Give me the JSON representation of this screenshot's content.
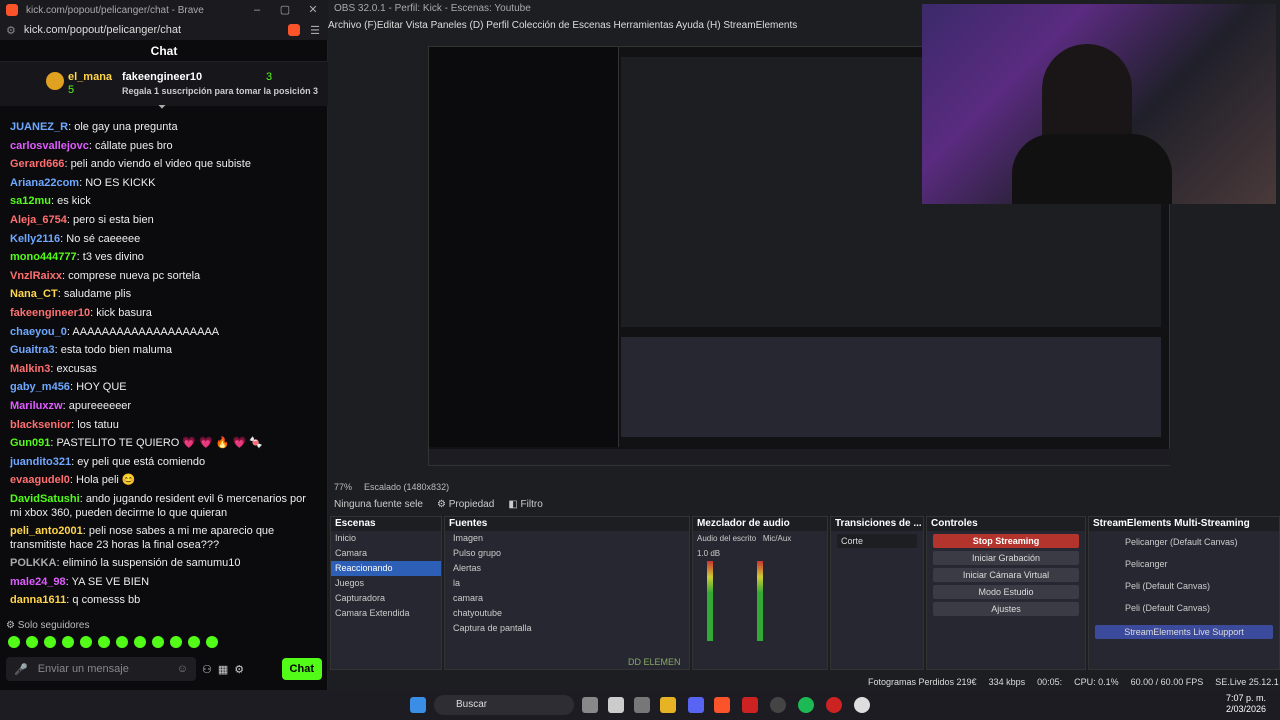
{
  "brave": {
    "title": "kick.com/popout/pelicanger/chat - Brave",
    "url": "kick.com/popout/pelicanger/chat",
    "chat_title": "Chat",
    "gift": {
      "user1": "el_mana",
      "count1": "5",
      "user2": "fakeengineer10",
      "count2": "3",
      "text": "Regala 1 suscripción para tomar la posición 3"
    },
    "messages": [
      {
        "user": "JUANEZ_R",
        "color": "#6fa8ff",
        "text": "ole gay una pregunta"
      },
      {
        "user": "carlosvallejovc",
        "color": "#e05cff",
        "text": "cállate pues bro"
      },
      {
        "user": "Gerard666",
        "color": "#ff6f6f",
        "text": "peli ando viendo el video que subiste"
      },
      {
        "user": "Ariana22com",
        "color": "#6fa8ff",
        "text": "NO ES KICKK"
      },
      {
        "user": "sa12mu",
        "color": "#53fc18",
        "text": "es kick"
      },
      {
        "user": "Aleja_6754",
        "color": "#ff6f6f",
        "text": "pero si esta bien"
      },
      {
        "user": "Kelly2116",
        "color": "#6fa8ff",
        "text": "No sé caeeeee"
      },
      {
        "user": "mono444777",
        "color": "#53fc18",
        "text": "t3 ves divino"
      },
      {
        "user": "VnzlRaixx",
        "color": "#ff6f6f",
        "text": "comprese nueva pc sortela"
      },
      {
        "user": "Nana_CT",
        "color": "#ffd54a",
        "text": "saludame plis"
      },
      {
        "user": "fakeengineer10",
        "color": "#ff6f6f",
        "text": "kick basura"
      },
      {
        "user": "chaeyou_0",
        "color": "#6fa8ff",
        "text": "AAAAAAAAAAAAAAAAAAAA"
      },
      {
        "user": "Guaitra3",
        "color": "#6fa8ff",
        "text": "esta todo bien maluma"
      },
      {
        "user": "Malkin3",
        "color": "#ff6f6f",
        "text": "excusas"
      },
      {
        "user": "gaby_m456",
        "color": "#6fa8ff",
        "text": "HOY QUE"
      },
      {
        "user": "Mariluxzw",
        "color": "#e05cff",
        "text": "apureeeeeer"
      },
      {
        "user": "blacksenior",
        "color": "#ff6f6f",
        "text": "los tatuu"
      },
      {
        "user": "Gun091",
        "color": "#53fc18",
        "text": "PASTELITO TE QUIERO 💗 💗 🔥 💗 🍬"
      },
      {
        "user": "juandito321",
        "color": "#6fa8ff",
        "text": "ey peli que está comiendo"
      },
      {
        "user": "evaagudel0",
        "color": "#ff6f6f",
        "text": "Hola peli 😊"
      },
      {
        "user": "DavidSatushi",
        "color": "#53fc18",
        "text": "ando jugando resident evil 6 mercenarios por mi xbox 360, pueden decirme lo que quieran"
      },
      {
        "user": "peli_anto2001",
        "color": "#ffd54a",
        "text": "peli nose sabes a mi me aparecio que transmitiste hace 23 horas la final osea???"
      },
      {
        "user": "POLKKA",
        "color": "#aaaaaa",
        "text": "eliminó la suspensión de samumu10"
      },
      {
        "user": "male24_98",
        "color": "#e05cff",
        "text": "YA SE VE BIEN"
      },
      {
        "user": "danna1611",
        "color": "#ffd54a",
        "text": "q comesss bb"
      }
    ],
    "mods_label": "Solo seguidores",
    "input_placeholder": "Enviar un mensaje",
    "chat_button": "Chat"
  },
  "obs": {
    "title": "OBS 32.0.1 - Perfil: Kick - Escenas: Youtube",
    "menu": "Archivo (F)Editar  Vista  Paneles (D)  Perfil  Colección de Escenas  Herramientas  Ayuda (H)  StreamElements",
    "zoom": "77%",
    "scaled": "Escalado (1480x832)",
    "no_source": "Ninguna fuente sele",
    "properties": "Propiedad",
    "filters": "Filtro",
    "scenes_title": "Escenas",
    "scenes": [
      "Inicio",
      "Camara",
      "Reaccionando",
      "Juegos",
      "Capturadora",
      "Camara Extendida"
    ],
    "selected_scene": "Reaccionando",
    "sources_title": "Fuentes",
    "sources": [
      "Imagen",
      "Pulso grupo",
      "Alertas",
      "la",
      "camara",
      "chatyoutube",
      "Captura de pantalla"
    ],
    "mixer_title": "Mezclador de audio",
    "mixer_ch1": "Audio del escrito",
    "mixer_ch2": "Mic/Aux",
    "mixer_db": "1.0 dB",
    "transitions_title": "Transiciones de ...",
    "transition": "Corte",
    "controls_title": "Controles",
    "controls": [
      "Stop Streaming",
      "Iniciar Grabación",
      "Iniciar Cámara Virtual",
      "Modo Estudio",
      "Ajustes"
    ],
    "se_title": "StreamElements Multi-Streaming",
    "se_items": [
      "Pelicanger (Default Canvas)",
      "Pelicanger",
      "Peli (Default Canvas)",
      "Peli (Default Canvas)"
    ],
    "se_support": "StreamElements Live Support",
    "dd": "DD ELEMEN",
    "status": {
      "dropped": "Fotogramas Perdidos 219€",
      "kbps": "334 kbps",
      "time": "00:05:",
      "cpu": "CPU: 0.1%",
      "fps": "60.00 / 60.00 FPS",
      "se": "SE.Live 25.12.1"
    }
  },
  "taskbar": {
    "search": "Buscar",
    "time": "7:07 p. m.",
    "date": "2/03/2026"
  }
}
